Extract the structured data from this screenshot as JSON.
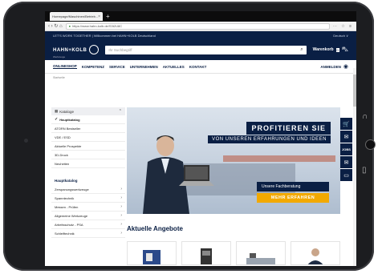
{
  "browser": {
    "tab_title": "Homepage/Maschinen/Betrieb...",
    "tab_close": "×",
    "new_tab": "+",
    "url": "https://www.hahn-kolb.de/S3t2U8C",
    "nav_icons": "‹ › ↻ ⌂",
    "right_icons": "⋯ ☆ ≡"
  },
  "site": {
    "slogan": "LET'S WORK TOGETHER  |  Willkommen bei HAHN+KOLB Deutschland",
    "language": "Deutsch ∨",
    "logo_text": "HAHN+KOLB",
    "logo_sub": "Werkzeuge",
    "search_placeholder": "Ihr Suchbegriff",
    "cart_label": "Warenkorb",
    "cart_count": "0",
    "nav": [
      "ONLINESHOP",
      "KOMPETENZ",
      "SERVICE",
      "UNTERNEHMEN",
      "AKTUELLES",
      "KONTAKT"
    ],
    "login": "ANMELDEN",
    "breadcrumb": "Startseite"
  },
  "sidebar": {
    "catalog_head": "Kataloge",
    "catalog_items": [
      "Hauptkatalog",
      "ATORN Bestseller",
      "VDE / ESD",
      "Aktuelle Prospekte",
      "3D-Druck",
      "Neuheiten"
    ],
    "main_head": "Hauptkatalog",
    "main_items": [
      "Zerspanungswerkzeuge",
      "Spanntechnik",
      "Messen - Prüfen",
      "Allgemeine Werkzeuge",
      "Arbeitsschutz - PSA",
      "Schleiftechnik"
    ]
  },
  "hero": {
    "title_line1": "PROFITIEREN SIE",
    "title_line2": "VON UNSEREN ERFAHRUNGEN UND IDEEN",
    "subtitle": "Unsere Fachberatung",
    "cta": "MEHR ERFAHREN"
  },
  "floaters": {
    "cart_icon": "🛒",
    "mail_icon": "✉",
    "jobs": "JOBS",
    "newsletter_icon": "✉",
    "chat_icon": "▭"
  },
  "offers_title": "Aktuelle Angebote",
  "colors": {
    "brand": "#0a1f44",
    "accent": "#f2a900"
  }
}
